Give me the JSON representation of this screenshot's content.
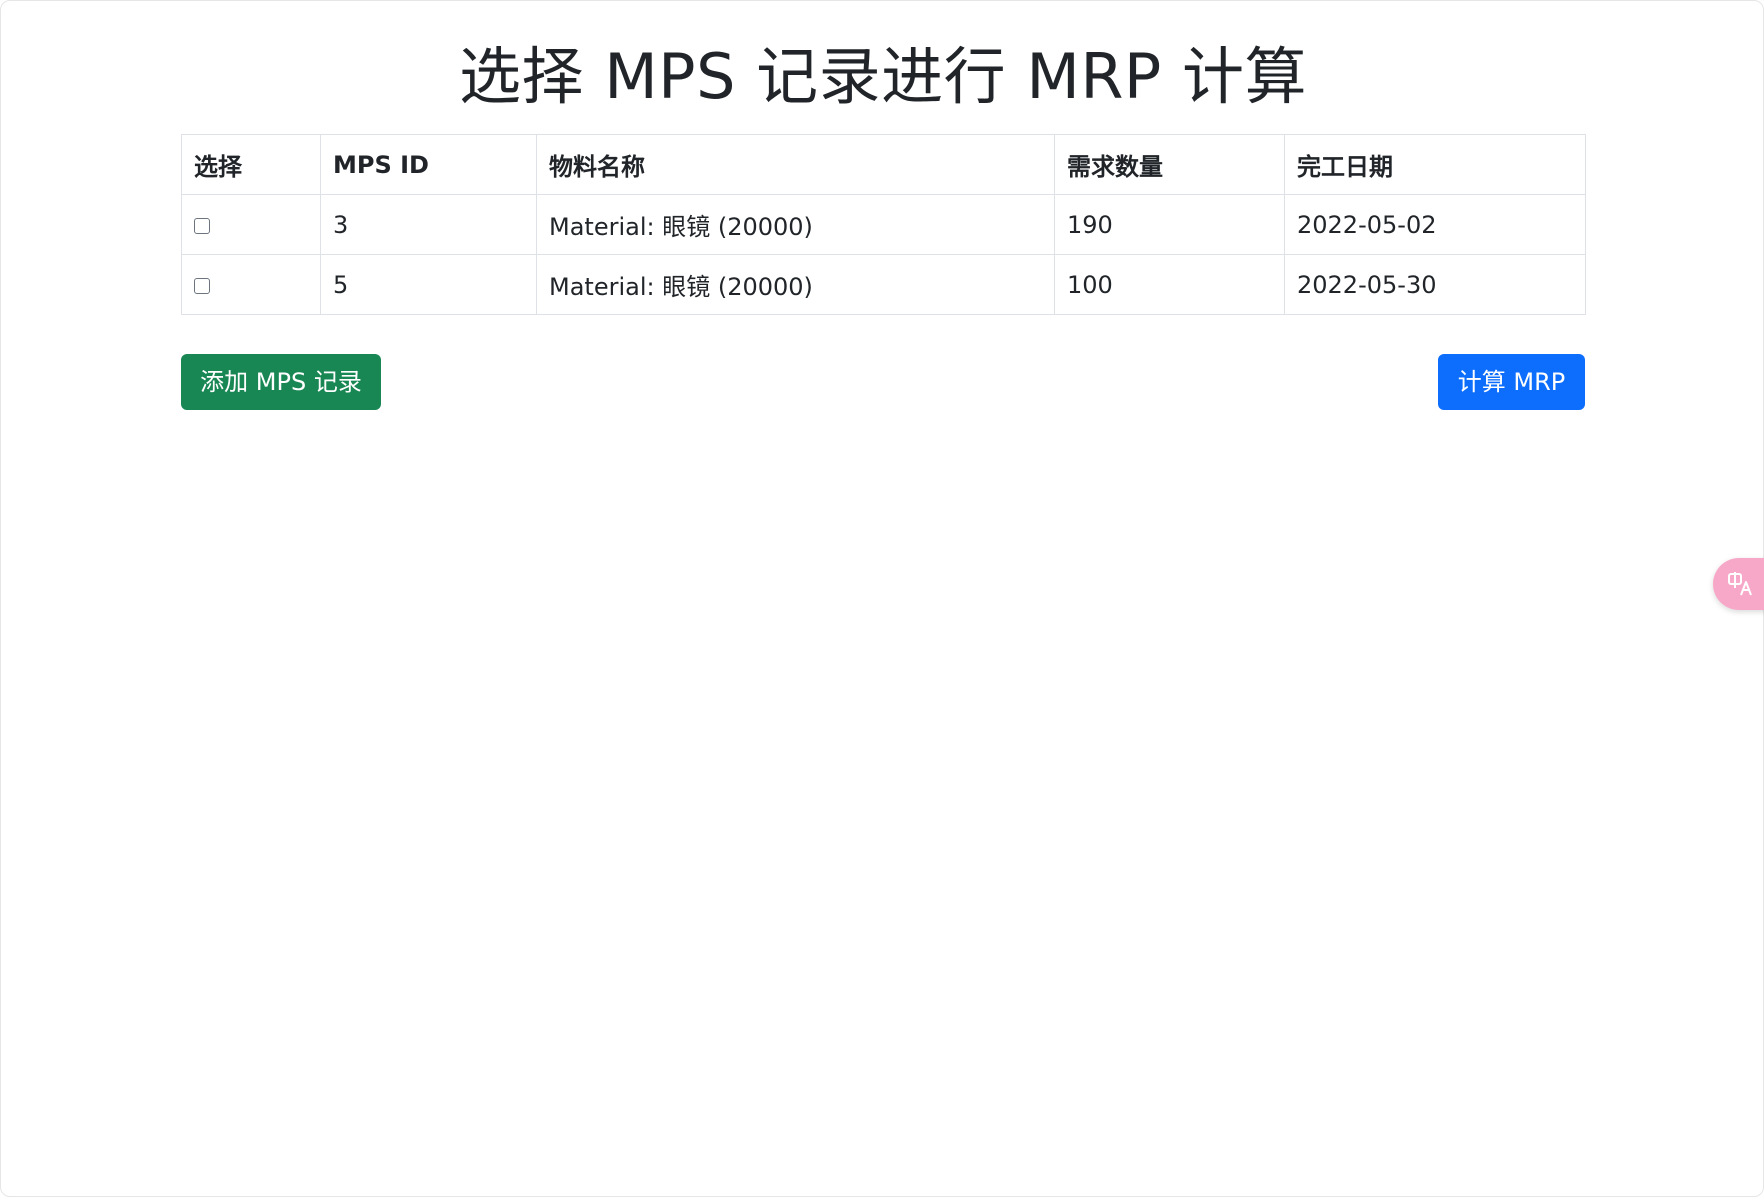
{
  "page": {
    "title": "选择 MPS 记录进行 MRP 计算"
  },
  "table": {
    "headers": {
      "select": "选择",
      "mps_id": "MPS ID",
      "material_name": "物料名称",
      "quantity": "需求数量",
      "due_date": "完工日期"
    },
    "rows": [
      {
        "checked": false,
        "mps_id": "3",
        "material_name": "Material: 眼镜 (20000)",
        "quantity": "190",
        "due_date": "2022-05-02"
      },
      {
        "checked": false,
        "mps_id": "5",
        "material_name": "Material: 眼镜 (20000)",
        "quantity": "100",
        "due_date": "2022-05-30"
      }
    ]
  },
  "actions": {
    "add_label": "添加 MPS 记录",
    "calculate_label": "计算 MRP"
  },
  "floating": {
    "translate_icon": "translate-icon"
  },
  "colors": {
    "add_button": "#198754",
    "calculate_button": "#0d6efd",
    "translate_fab": "#f7a8c8"
  }
}
